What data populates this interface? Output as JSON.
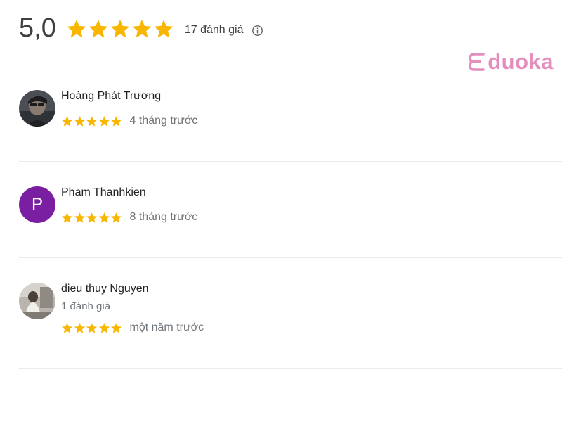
{
  "summary": {
    "rating": "5,0",
    "stars": 5,
    "review_count": "17 đánh giá",
    "info_icon": "info-icon"
  },
  "watermark": {
    "logo_letter": "E",
    "text": "duoka"
  },
  "colors": {
    "star": "#f9b600",
    "divider": "#e8eaed",
    "avatar_letter_bg": "#7b1fa2",
    "watermark": "#e48ebd"
  },
  "reviews": [
    {
      "name": "Hoàng Phát Trương",
      "avatar": "photo-avatar",
      "meta": "",
      "stars": 5,
      "time": "4 tháng trước"
    },
    {
      "name": "Pham Thanhkien",
      "avatar": "letter-avatar",
      "avatar_letter": "P",
      "meta": "",
      "stars": 5,
      "time": "8 tháng trước"
    },
    {
      "name": "dieu thuy Nguyen",
      "avatar": "photo-avatar",
      "meta": "1 đánh giá",
      "stars": 5,
      "time": "một năm trước"
    }
  ]
}
